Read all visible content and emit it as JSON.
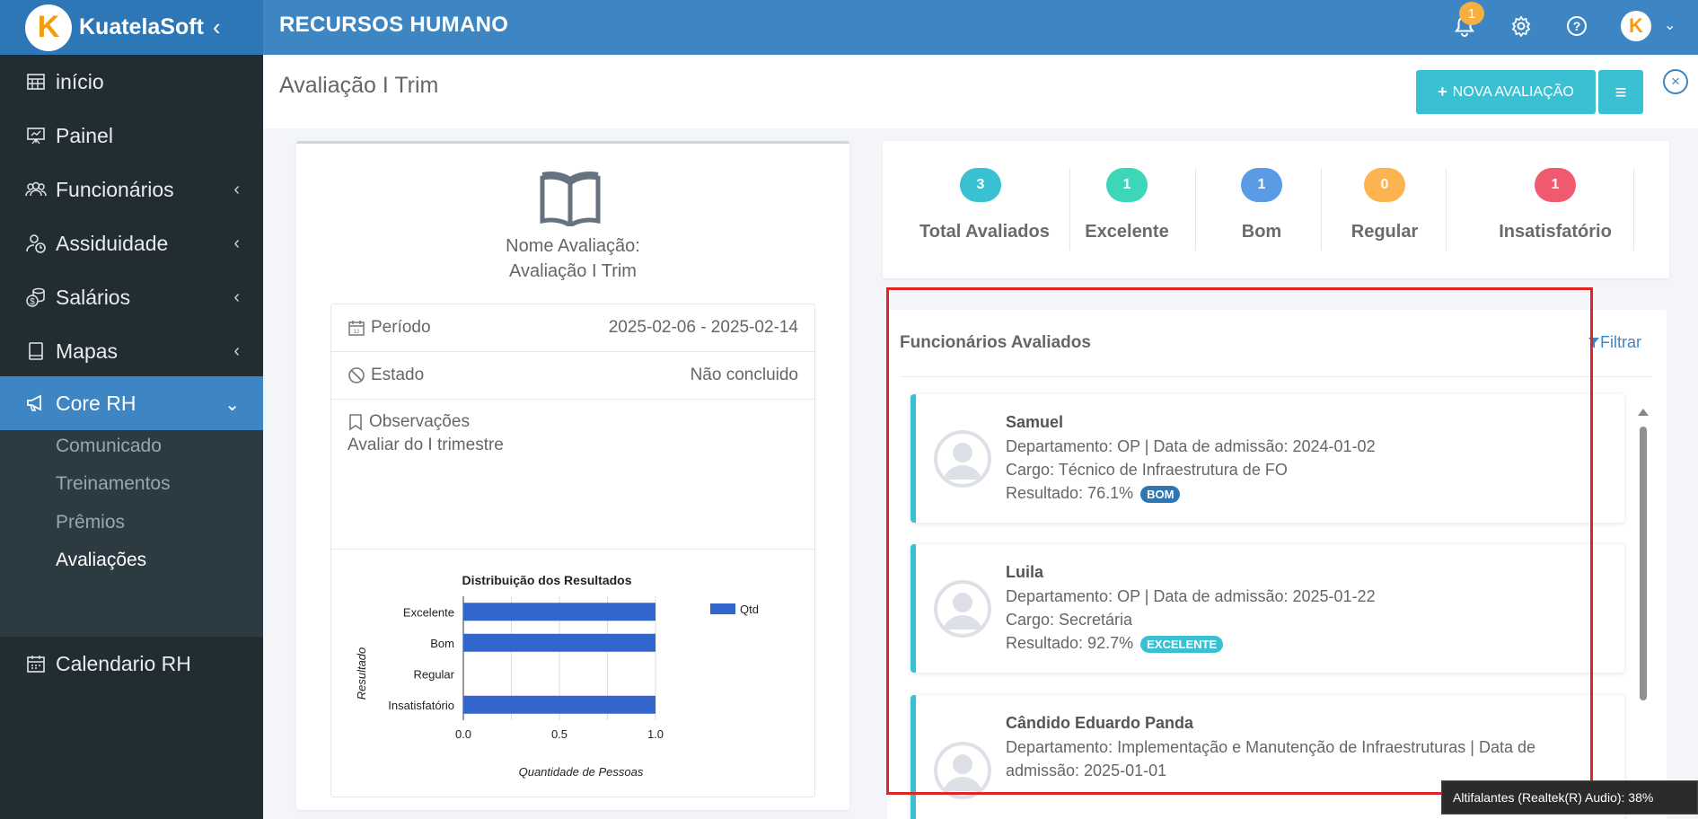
{
  "brand": {
    "logo_letter": "K",
    "name": "KuatelaSoft",
    "collapse_icon": "chevron-left-icon"
  },
  "app": {
    "title": "RECURSOS HUMANO"
  },
  "topbar": {
    "notifications_count": "1",
    "user_initial": "K"
  },
  "sidebar": {
    "items": [
      {
        "label": "início",
        "icon": "dashboard-grid-icon"
      },
      {
        "label": "Painel",
        "icon": "presentation-icon"
      },
      {
        "label": "Funcionários",
        "icon": "users-icon"
      },
      {
        "label": "Assiduidade",
        "icon": "user-clock-icon"
      },
      {
        "label": "Salários",
        "icon": "coins-icon"
      },
      {
        "label": "Mapas",
        "icon": "book-icon"
      },
      {
        "label": "Core RH",
        "icon": "megaphone-icon"
      },
      {
        "label": "Calendario RH",
        "icon": "calendar-icon"
      }
    ],
    "sub_items": [
      "Comunicado",
      "Treinamentos",
      "Prêmios",
      "Avaliações"
    ]
  },
  "page": {
    "title": "Avaliação I Trim",
    "new_button": "NOVA AVALIAÇÃO"
  },
  "evaluation": {
    "name_label": "Nome Avaliação:",
    "name_value": "Avaliação I Trim",
    "period_label": "Período",
    "period_value": "2025-02-06 - 2025-02-14",
    "state_label": "Estado",
    "state_value": "Não concluido",
    "obs_label": "Observações",
    "obs_text": "Avaliar do I trimestre"
  },
  "chart_data": {
    "type": "bar",
    "orientation": "horizontal",
    "title": "Distribuição dos Resultados",
    "categories": [
      "Excelente",
      "Bom",
      "Regular",
      "Insatisfatório"
    ],
    "series": [
      {
        "name": "Qtd",
        "values": [
          1,
          1,
          0,
          1
        ],
        "color": "#3366cc"
      }
    ],
    "xlabel": "Quantidade de Pessoas",
    "ylabel": "Resultado",
    "xlim": [
      0,
      1
    ],
    "x_ticks": [
      "0.0",
      "0.5",
      "1.0"
    ],
    "legend": "top-right",
    "grid": true
  },
  "stats": [
    {
      "value": "3",
      "label": "Total Avaliados",
      "color": "#39c1d3"
    },
    {
      "value": "1",
      "label": "Excelente",
      "color": "#3dd6b8"
    },
    {
      "value": "1",
      "label": "Bom",
      "color": "#5b9be6"
    },
    {
      "value": "0",
      "label": "Regular",
      "color": "#fbb450"
    },
    {
      "value": "1",
      "label": "Insatisfatório",
      "color": "#f05a6e"
    }
  ],
  "employees_panel": {
    "title": "Funcionários Avaliados",
    "filter_label": "Filtrar"
  },
  "employees": [
    {
      "name": "Samuel",
      "department_line": "Departamento: OP | Data de admissão: 2024-01-02",
      "role_line": "Cargo: Técnico de Infraestrutura de FO",
      "result_line": "Resultado: 76.1%",
      "badge": "BOM",
      "badge_color": "#2e77b6"
    },
    {
      "name": "Luila",
      "department_line": "Departamento: OP | Data de admissão: 2025-01-22",
      "role_line": "Cargo: Secretária",
      "result_line": "Resultado: 92.7%",
      "badge": "EXCELENTE",
      "badge_color": "#39c1d3"
    },
    {
      "name": "Cândido Eduardo Panda",
      "department_line": "Departamento: Implementação e Manutenção de Infraestruturas | Data de",
      "department_line2": "admissão: 2025-01-01"
    }
  ],
  "tooltip": {
    "text": "Altifalantes (Realtek(R) Audio): 38%"
  }
}
